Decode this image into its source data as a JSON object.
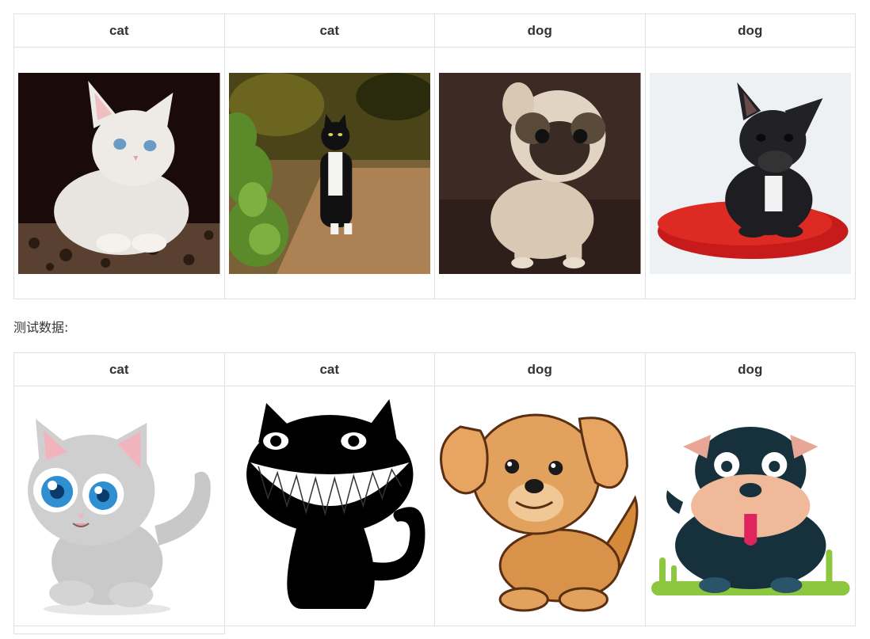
{
  "table1": {
    "headers": [
      "cat",
      "cat",
      "dog",
      "dog"
    ],
    "images": [
      {
        "icon": "white-kitten-photo"
      },
      {
        "icon": "black-white-cat-on-path-photo"
      },
      {
        "icon": "pug-puppy-photo"
      },
      {
        "icon": "french-bulldog-on-red-pillow-photo"
      }
    ]
  },
  "test_label": "测试数据:",
  "table2": {
    "headers": [
      "cat",
      "cat",
      "dog",
      "dog"
    ],
    "images": [
      {
        "icon": "cartoon-grey-kitten-illustration"
      },
      {
        "icon": "cartoon-grinning-black-cat-illustration"
      },
      {
        "icon": "cartoon-brown-puppy-illustration"
      },
      {
        "icon": "cartoon-bulldog-illustration"
      }
    ]
  }
}
